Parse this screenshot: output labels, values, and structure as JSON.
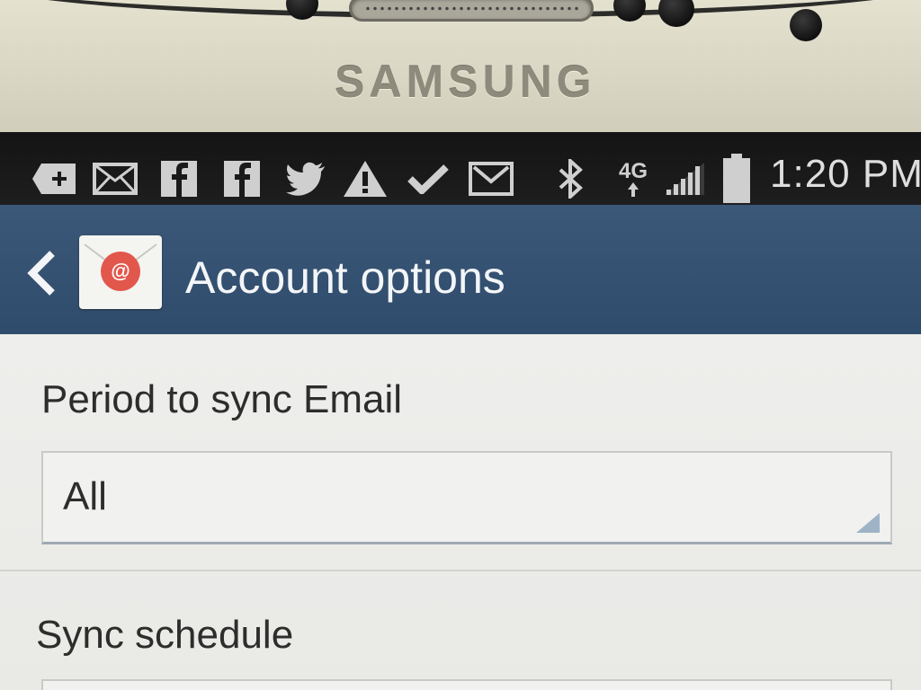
{
  "device": {
    "brand": "SAMSUNG"
  },
  "status_bar": {
    "icons": [
      "add-icon",
      "email-icon",
      "facebook-icon",
      "facebook-icon",
      "twitter-icon",
      "warning-icon",
      "checkmark-icon",
      "gmail-icon",
      "bluetooth-icon",
      "4g-network-icon",
      "signal-icon",
      "battery-icon"
    ],
    "network_label": "4G",
    "time": "1:20 PM"
  },
  "action_bar": {
    "title": "Account options",
    "color": "#33506f"
  },
  "settings": {
    "period_label": "Period to sync Email",
    "period_value": "All",
    "schedule_label": "Sync schedule"
  }
}
